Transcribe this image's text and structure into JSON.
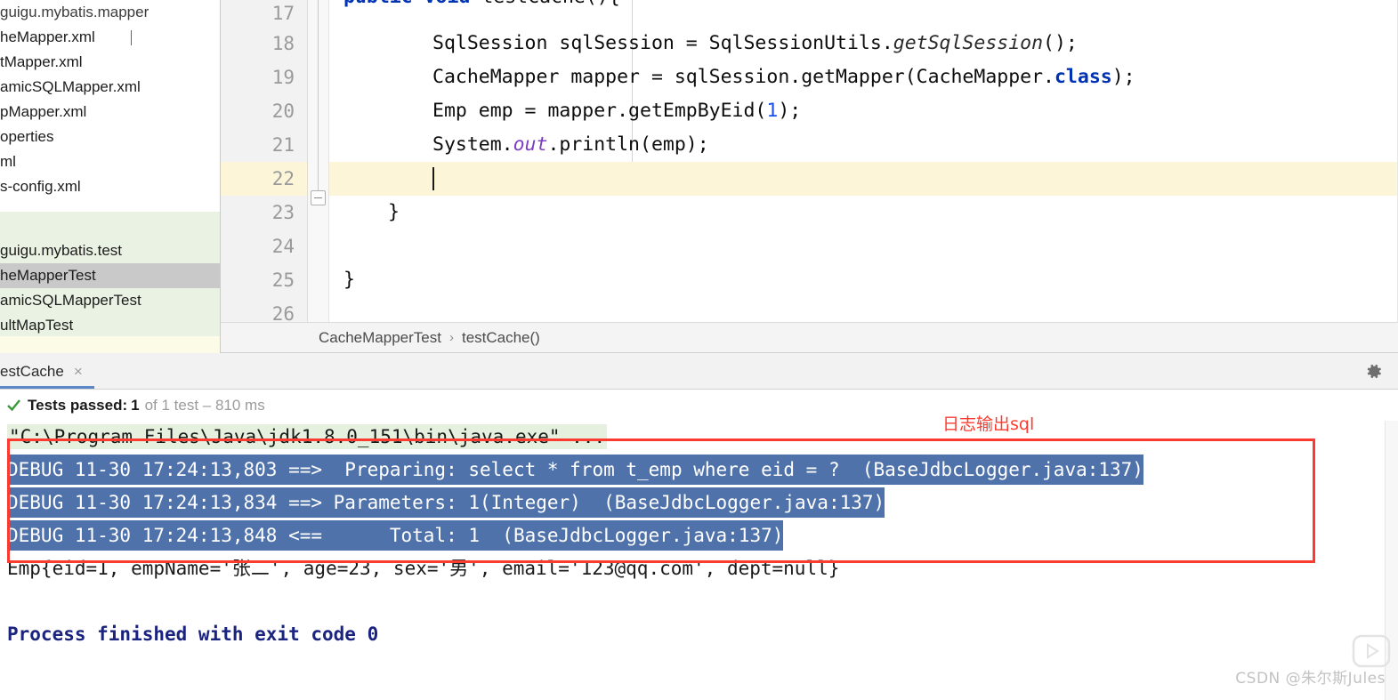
{
  "sidebar": {
    "name": "project-tool-window",
    "main_items": [
      {
        "label": "guigu.mybatis.mapper",
        "selected": false,
        "truncated": true
      },
      {
        "label": "heMapper.xml",
        "selected": false,
        "caret": true
      },
      {
        "label": "tMapper.xml",
        "selected": false
      },
      {
        "label": "amicSQLMapper.xml",
        "selected": false
      },
      {
        "label": "pMapper.xml",
        "selected": false
      },
      {
        "label": "operties",
        "selected": false
      },
      {
        "label": "ml",
        "selected": false
      },
      {
        "label": "s-config.xml",
        "selected": false
      }
    ],
    "test_items": [
      {
        "label": "guigu.mybatis.test",
        "selected": false
      },
      {
        "label": "heMapperTest",
        "selected": true
      },
      {
        "label": "amicSQLMapperTest",
        "selected": false
      },
      {
        "label": "ultMapTest",
        "selected": false
      }
    ]
  },
  "editor": {
    "name": "code-editor",
    "lines": [
      {
        "num": "17",
        "text": "public void testCache(){",
        "clipped": true,
        "run_gutter_icon": "run-arrow-icon"
      },
      {
        "num": "18",
        "text": "SqlSession sqlSession = SqlSessionUtils.getSqlSession();"
      },
      {
        "num": "19",
        "text": "CacheMapper mapper = sqlSession.getMapper(CacheMapper.class);"
      },
      {
        "num": "20",
        "text": "Emp emp = mapper.getEmpByEid(1);"
      },
      {
        "num": "21",
        "text": "System.out.println(emp);"
      },
      {
        "num": "22",
        "text": "",
        "current": true
      },
      {
        "num": "23",
        "text": "}"
      },
      {
        "num": "24",
        "text": ""
      },
      {
        "num": "25",
        "text": "}"
      },
      {
        "num": "26",
        "text": ""
      }
    ]
  },
  "breadcrumb": {
    "name": "editor-breadcrumb",
    "class_name": "CacheMapperTest",
    "separator": "›",
    "method_name": "testCache()"
  },
  "test_panel": {
    "tab_label": "estCache",
    "tab_close": "×",
    "gear_icon": "gear-icon",
    "status": {
      "check_icon": "check-icon",
      "prefix": "Tests passed:",
      "count": "1",
      "suffix": "of 1 test – 810 ms"
    }
  },
  "console": {
    "name": "run-console",
    "lines": [
      {
        "kind": "cmd",
        "text": "\"C:\\Program Files\\Java\\jdk1.8.0_151\\bin\\java.exe\" ..."
      },
      {
        "kind": "sel",
        "text": "DEBUG 11-30 17:24:13,803 ==>  Preparing: select * from t_emp where eid = ?  (BaseJdbcLogger.java:137)"
      },
      {
        "kind": "sel",
        "text": "DEBUG 11-30 17:24:13,834 ==> Parameters: 1(Integer)  (BaseJdbcLogger.java:137)"
      },
      {
        "kind": "sel",
        "text": "DEBUG 11-30 17:24:13,848 <==      Total: 1  (BaseJdbcLogger.java:137)"
      },
      {
        "kind": "out",
        "text": "Emp{eid=1, empName='张二', age=23, sex='男', email='123@qq.com', dept=null}"
      },
      {
        "kind": "blank",
        "text": ""
      },
      {
        "kind": "exit",
        "text": "Process finished with exit code 0"
      }
    ]
  },
  "annotation": {
    "name": "red-annotation",
    "label": "日志输出sql",
    "color": "#fb3b30"
  },
  "watermark": {
    "text": "CSDN @朱尔斯Jules"
  },
  "colors": {
    "selection_blue": "#4f72ab",
    "annotation_red": "#fb3b30",
    "current_line": "#fdf5d8",
    "test_group_green": "#eaf3e3",
    "tab_underline": "#5b87c7"
  }
}
